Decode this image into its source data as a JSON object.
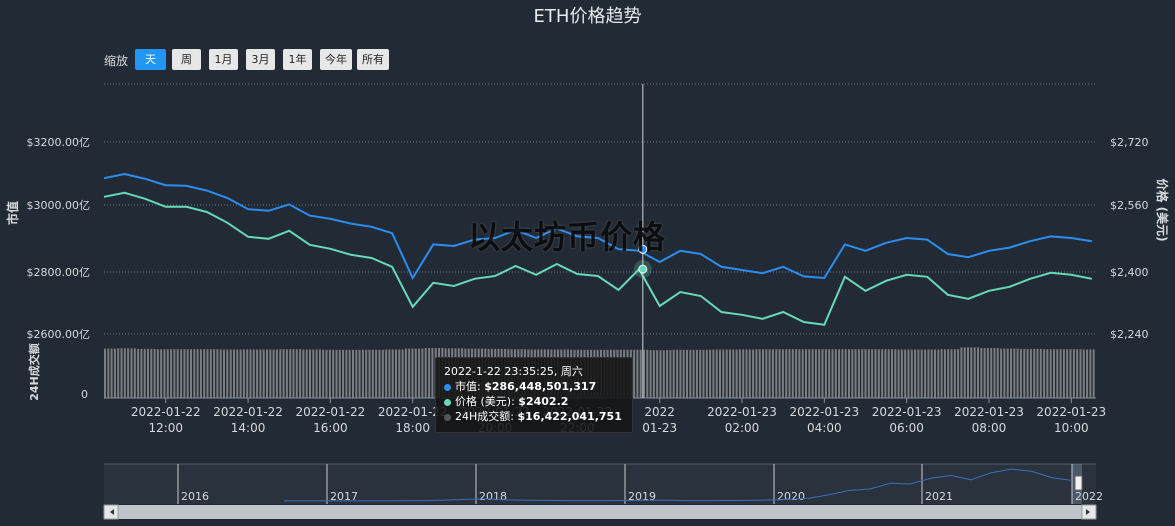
{
  "title": "ETH价格趋势",
  "zoom": {
    "label": "缩放",
    "buttons": [
      "天",
      "周",
      "1月",
      "3月",
      "1年",
      "今年",
      "所有"
    ],
    "active": "天"
  },
  "watermark": "以太坊币价格",
  "colors": {
    "market_cap": "#2b8eef",
    "price": "#67d9b8",
    "volume": "#9a9a9a",
    "navigator": "#3b6fb6",
    "background": "#222a35"
  },
  "tooltip": {
    "time": "2022-1-22 23:35:25, 周六",
    "rows": [
      {
        "label": "市值: ",
        "value": "$286,448,501,317",
        "color": "#2b8eef"
      },
      {
        "label": "价格 (美元): ",
        "value": "$2402.2",
        "color": "#67d9b8"
      },
      {
        "label": "24H成交额: ",
        "value": "$16,422,041,751",
        "color": "#555555"
      }
    ]
  },
  "chart_data": {
    "type": "line",
    "x_tick_labels": [
      [
        "2022-01-22",
        "12:00"
      ],
      [
        "2022-01-22",
        "14:00"
      ],
      [
        "2022-01-22",
        "16:00"
      ],
      [
        "2022-01-22",
        "18:00"
      ],
      [
        "2022-01-22",
        "20:00"
      ],
      [
        "2022-01-22",
        "22:00"
      ],
      [
        "2022",
        "01-23"
      ],
      [
        "2022-01-23",
        "02:00"
      ],
      [
        "2022-01-23",
        "04:00"
      ],
      [
        "2022-01-23",
        "06:00"
      ],
      [
        "2022-01-23",
        "08:00"
      ],
      [
        "2022-01-23",
        "10:00"
      ]
    ],
    "y_left": {
      "label": "市值",
      "ticks": [
        "$3200.00亿",
        "$3000.00亿",
        "$2800.00亿",
        "$2600.00亿"
      ],
      "ylim": [
        2600,
        3370
      ]
    },
    "y_right": {
      "label": "价格 (美元)",
      "ticks": [
        "$2,720",
        "$2,560",
        "$2,400",
        "$2,240"
      ]
    },
    "y_volume": {
      "label": "24H成交额",
      "ticks": [
        "0"
      ]
    },
    "x_hours": [
      10.5,
      11,
      11.5,
      12,
      12.5,
      13,
      13.5,
      14,
      14.5,
      15,
      15.5,
      16,
      16.5,
      17,
      17.5,
      18,
      18.5,
      19,
      19.5,
      20,
      20.5,
      21,
      21.5,
      22,
      22.5,
      23,
      23.5,
      24,
      24.5,
      25,
      25.5,
      26,
      26.5,
      27,
      27.5,
      28,
      28.5,
      29,
      29.5,
      30,
      30.5,
      31,
      31.5,
      32,
      32.5,
      33,
      33.5,
      34,
      34.5
    ],
    "series": [
      {
        "name": "市值",
        "values": [
          3087,
          3100,
          3085,
          3065,
          3063,
          3048,
          3025,
          2990,
          2985,
          3005,
          2970,
          2960,
          2945,
          2935,
          2915,
          2775,
          2880,
          2875,
          2895,
          2900,
          2925,
          2900,
          2930,
          2905,
          2900,
          2865,
          2860,
          2825,
          2860,
          2850,
          2810,
          2800,
          2790,
          2810,
          2780,
          2775,
          2880,
          2860,
          2885,
          2900,
          2895,
          2850,
          2840,
          2860,
          2870,
          2890,
          2905,
          2900,
          2890
        ]
      },
      {
        "name": "价格 (美元)",
        "values": [
          2583,
          2593,
          2578,
          2558,
          2558,
          2545,
          2518,
          2483,
          2478,
          2498,
          2463,
          2453,
          2438,
          2430,
          2408,
          2308,
          2368,
          2360,
          2378,
          2385,
          2410,
          2388,
          2415,
          2390,
          2385,
          2350,
          2402,
          2310,
          2345,
          2335,
          2295,
          2288,
          2278,
          2295,
          2270,
          2263,
          2383,
          2348,
          2373,
          2388,
          2383,
          2338,
          2328,
          2348,
          2358,
          2378,
          2393,
          2388,
          2378
        ]
      }
    ],
    "volume_values": [
      16.8,
      16.9,
      16.7,
      16.6,
      16.6,
      16.6,
      16.5,
      16.5,
      16.5,
      16.6,
      16.5,
      16.4,
      16.4,
      16.4,
      16.5,
      16.8,
      17.0,
      16.9,
      16.8,
      16.7,
      16.6,
      16.5,
      16.5,
      16.4,
      16.4,
      16.4,
      16.42,
      16.3,
      16.4,
      16.4,
      16.5,
      16.5,
      16.6,
      16.6,
      16.6,
      16.6,
      16.6,
      16.6,
      16.6,
      16.5,
      16.5,
      16.6,
      17.2,
      17.0,
      16.8,
      16.7,
      16.6,
      16.6,
      16.5
    ],
    "crosshair_hour": 23.59,
    "navigator": {
      "year_labels": [
        "2016",
        "2017",
        "2018",
        "2019",
        "2020",
        "2021",
        "2022"
      ],
      "values": [
        1,
        1,
        1,
        1,
        1,
        2,
        3,
        5,
        12,
        22,
        30,
        16,
        10,
        8,
        6,
        5,
        5,
        7,
        12,
        10,
        6,
        6,
        7,
        8,
        14,
        22,
        40,
        90,
        150,
        170,
        250,
        240,
        320,
        360,
        300,
        400,
        450,
        420,
        330,
        290
      ]
    }
  }
}
